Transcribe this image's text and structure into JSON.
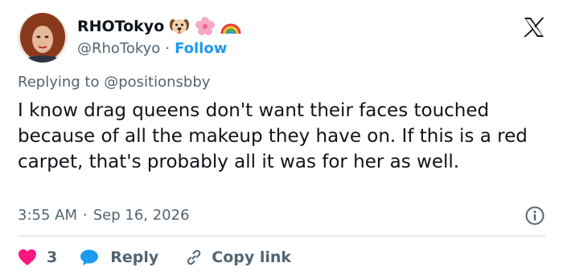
{
  "author": {
    "display_name": "RHOTokyo",
    "emojis": [
      "dog-face-emoji",
      "cherry-blossom-emoji",
      "rainbow-emoji"
    ],
    "handle": "@RhoTokyo",
    "separator": "·",
    "follow_label": "Follow"
  },
  "replying": {
    "prefix": "Replying to",
    "mention": "@positionsbby"
  },
  "tweet": {
    "text": "I know drag queens don't want their faces touched because of all the makeup they have on. If this is a red carpet, that's probably all it was for her as well."
  },
  "meta": {
    "time": "3:55 AM",
    "separator": "·",
    "date": "Sep 16, 2026"
  },
  "actions": {
    "like_count": "3",
    "reply_label": "Reply",
    "copy_label": "Copy link"
  },
  "colors": {
    "accent": "#1d9bf0",
    "like": "#f91880",
    "muted": "#536471",
    "text": "#0f1419",
    "divider": "#cfd9de"
  }
}
